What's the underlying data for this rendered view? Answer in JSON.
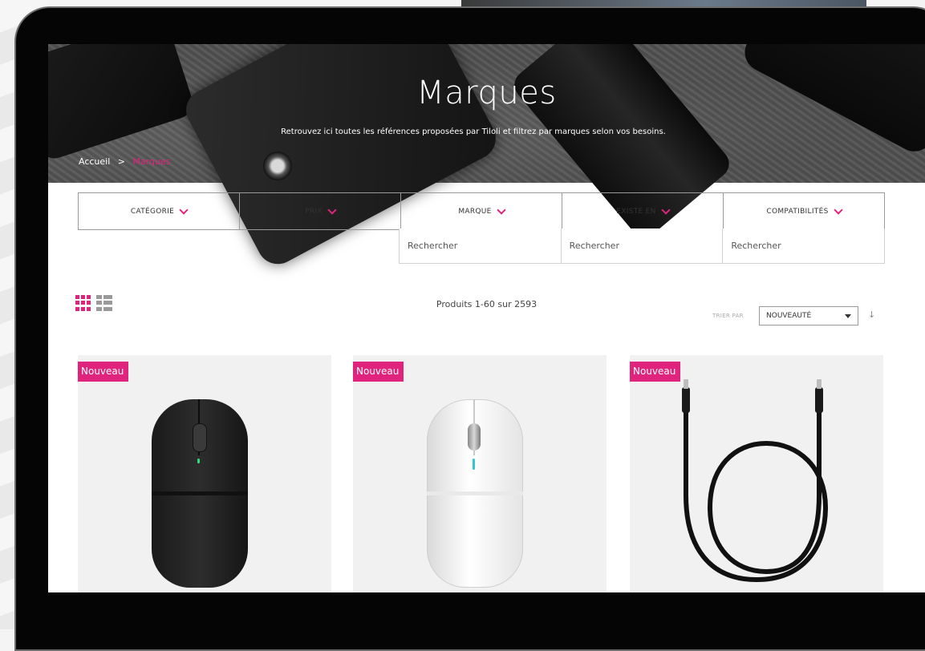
{
  "hero": {
    "title": "Marques",
    "subtitle": "Retrouvez ici toutes les références proposées par Tiloli et filtrez par marques selon vos besoins."
  },
  "breadcrumb": {
    "home": "Accueil",
    "separator": ">",
    "current": "Marques"
  },
  "filters": [
    {
      "label": "CATÉGORIE"
    },
    {
      "label": "PRIX"
    },
    {
      "label": "MARQUE"
    },
    {
      "label": "EXISTE EN"
    },
    {
      "label": "COMPATIBILITÉS"
    }
  ],
  "search_fields": [
    {
      "placeholder": "Rechercher"
    },
    {
      "placeholder": "Rechercher"
    },
    {
      "placeholder": "Rechercher"
    }
  ],
  "toolbar": {
    "count_text": "Produits 1-60 sur 2593",
    "sort_label": "TRIER PAR",
    "sort_value": "NOUVEAUTÉ",
    "sort_direction_icon": "↓"
  },
  "products": [
    {
      "badge": "Nouveau",
      "image": "black-wireless-mouse"
    },
    {
      "badge": "Nouveau",
      "image": "white-wireless-mouse"
    },
    {
      "badge": "Nouveau",
      "image": "black-usb-c-cable"
    }
  ],
  "colors": {
    "accent": "#e0237c",
    "badge_text": "#ffffff",
    "border": "#9a9a9a",
    "card_bg": "#f1f1f1"
  }
}
